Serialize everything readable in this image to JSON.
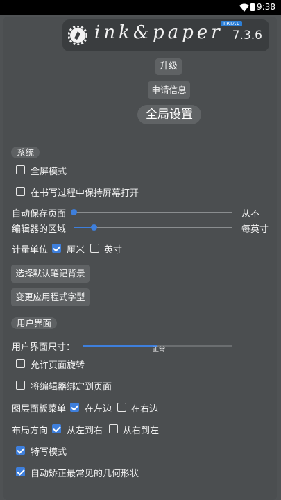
{
  "status_bar": {
    "time": "9:38"
  },
  "app": {
    "brand": "ink&paper",
    "trial_badge": "TRIAL",
    "version": "7.3.6"
  },
  "buttons": {
    "upgrade": "升级",
    "apply_info": "申请信息",
    "choose_background": "选择默认笔记背景",
    "change_font": "变更应用程式字型"
  },
  "page_title": "全局设置",
  "system": {
    "section_label": "系统",
    "fullscreen": {
      "label": "全屏模式",
      "checked": false
    },
    "keep_screen_on": {
      "label": "在书写过程中保持屏幕打开",
      "checked": false
    },
    "autosave": {
      "label": "自动保存页面",
      "value_text": "从不",
      "level": 0
    },
    "editor_area": {
      "label": "编辑器的区域",
      "value_text": "每英寸",
      "level": 0.13
    },
    "unit": {
      "label": "计量单位",
      "options": [
        {
          "label": "厘米",
          "checked": true
        },
        {
          "label": "英寸",
          "checked": false
        }
      ]
    }
  },
  "ui": {
    "section_label": "用户界面",
    "ui_size": {
      "label": "用户界面尺寸：",
      "value_text": "正常",
      "level": 0.5
    },
    "allow_rotation": {
      "label": "允许页面旋转",
      "checked": false
    },
    "bind_editor": {
      "label": "将编辑器绑定到页面",
      "checked": false
    },
    "layer_panel": {
      "label": "图层面板菜单",
      "options": [
        {
          "label": "在左边",
          "checked": true
        },
        {
          "label": "在右边",
          "checked": false
        }
      ]
    },
    "layout_direction": {
      "label": "布局方向",
      "options": [
        {
          "label": "从左到右",
          "checked": true
        },
        {
          "label": "从右到左",
          "checked": false
        }
      ]
    },
    "closeup_mode": {
      "label": "特写模式",
      "checked": true
    },
    "auto_correct_shapes": {
      "label": "自动矫正最常见的几何形状",
      "checked": true
    }
  }
}
